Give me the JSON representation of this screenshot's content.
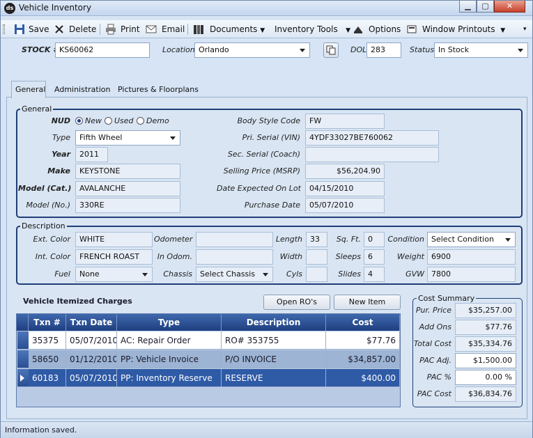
{
  "window": {
    "title": "Vehicle Inventory",
    "app_icon": "ds"
  },
  "toolbar": {
    "save": "Save",
    "delete": "Delete",
    "print": "Print",
    "email": "Email",
    "documents": "Documents",
    "inventory_tools": "Inventory Tools",
    "options": "Options",
    "window_printouts": "Window Printouts"
  },
  "header": {
    "stock_label": "STOCK #",
    "stock_value": "KS60062",
    "location_label": "Location",
    "location_value": "Orlando",
    "dol_label": "DOL",
    "dol_value": "283",
    "status_label": "Status",
    "status_value": "In Stock"
  },
  "tabs": [
    "General",
    "Administration",
    "Pictures & Floorplans"
  ],
  "general": {
    "title": "General",
    "nud_label": "NUD",
    "nud_options": [
      "New",
      "Used",
      "Demo"
    ],
    "type_label": "Type",
    "type_value": "Fifth Wheel",
    "year_label": "Year",
    "year_value": "2011",
    "make_label": "Make",
    "make_value": "KEYSTONE",
    "model_cat_label": "Model (Cat.)",
    "model_cat_value": "AVALANCHE",
    "model_no_label": "Model (No.)",
    "model_no_value": "330RE",
    "body_style_label": "Body Style Code",
    "body_style_value": "FW",
    "pri_serial_label": "Pri. Serial (VIN)",
    "pri_serial_value": "4YDF33027BE760062",
    "sec_serial_label": "Sec. Serial (Coach)",
    "sec_serial_value": "",
    "selling_price_label": "Selling Price (MSRP)",
    "selling_price_value": "$56,204.90",
    "date_expected_label": "Date Expected On Lot",
    "date_expected_value": "04/15/2010",
    "purchase_date_label": "Purchase Date",
    "purchase_date_value": "05/07/2010"
  },
  "description": {
    "title": "Description",
    "ext_color_label": "Ext. Color",
    "ext_color_value": "WHITE",
    "int_color_label": "Int. Color",
    "int_color_value": "FRENCH ROAST",
    "fuel_label": "Fuel",
    "fuel_value": "None",
    "odometer_label": "Odometer",
    "odometer_value": "",
    "in_odom_label": "In Odom.",
    "in_odom_value": "",
    "chassis_label": "Chassis",
    "chassis_value": "Select Chassis",
    "length_label": "Length",
    "length_value": "33",
    "width_label": "Width",
    "width_value": "",
    "cyls_label": "Cyls",
    "cyls_value": "",
    "sqft_label": "Sq. Ft.",
    "sqft_value": "0",
    "sleeps_label": "Sleeps",
    "sleeps_value": "6",
    "slides_label": "Slides",
    "slides_value": "4",
    "condition_label": "Condition",
    "condition_value": "Select Condition",
    "weight_label": "Weight",
    "weight_value": "6900",
    "gvw_label": "GVW",
    "gvw_value": "7800"
  },
  "charges": {
    "title": "Vehicle Itemized Charges",
    "open_ros": "Open RO's",
    "new_item": "New Item",
    "columns": [
      "Txn #",
      "Txn Date",
      "Type",
      "Description",
      "Cost"
    ],
    "rows": [
      [
        "35375",
        "05/07/2010",
        "AC: Repair Order",
        "RO# 353755",
        "$77.76"
      ],
      [
        "58650",
        "01/12/2010",
        "PP: Vehicle Invoice",
        "P/O INVOICE",
        "$34,857.00"
      ],
      [
        "60183",
        "05/07/2010",
        "PP: Inventory Reserve",
        "RESERVE",
        "$400.00"
      ]
    ]
  },
  "cost_summary": {
    "title": "Cost Summary",
    "pur_price_label": "Pur. Price",
    "pur_price_value": "$35,257.00",
    "add_ons_label": "Add Ons",
    "add_ons_value": "$77.76",
    "total_cost_label": "Total Cost",
    "total_cost_value": "$35,334.76",
    "pac_adj_label": "PAC Adj.",
    "pac_adj_value": "$1,500.00",
    "pac_pct_label": "PAC %",
    "pac_pct_value": "0.00 %",
    "pac_cost_label": "PAC Cost",
    "pac_cost_value": "$36,834.76"
  },
  "status": {
    "message": "Information saved."
  }
}
